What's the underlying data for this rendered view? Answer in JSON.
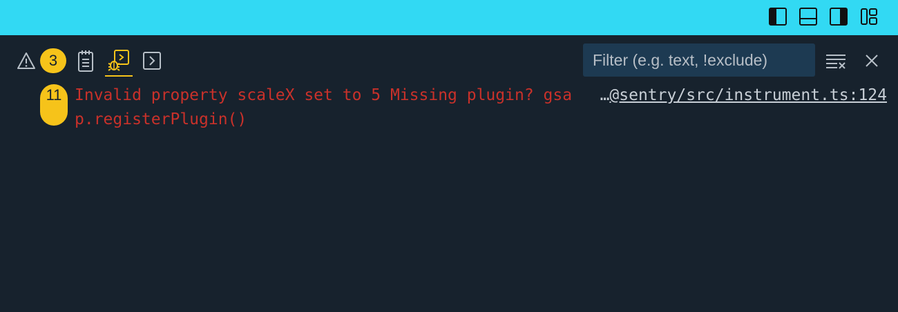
{
  "titlebar": {
    "background": "#32d9f3",
    "layout_buttons": [
      "toggle-primary-sidebar-icon",
      "toggle-panel-icon",
      "toggle-secondary-sidebar-icon",
      "customize-layout-icon"
    ]
  },
  "panel": {
    "tabs": [
      {
        "name": "problems",
        "icon": "warning-icon",
        "badge": "3"
      },
      {
        "name": "output",
        "icon": "notepad-icon"
      },
      {
        "name": "debug-console",
        "icon": "debug-console-icon",
        "active": true
      },
      {
        "name": "terminal",
        "icon": "terminal-icon"
      }
    ],
    "filter": {
      "placeholder": "Filter (e.g. text, !exclude)",
      "value": ""
    },
    "accent": "#f6c31a"
  },
  "console": {
    "entries": [
      {
        "count": "11",
        "message": "Invalid property scaleX set to 5 Missing plugin? gsap.registerPlugin()",
        "source_ellipsis": "…",
        "source": "@sentry/src/instrument.ts:124",
        "color": "#c9312a"
      }
    ]
  }
}
